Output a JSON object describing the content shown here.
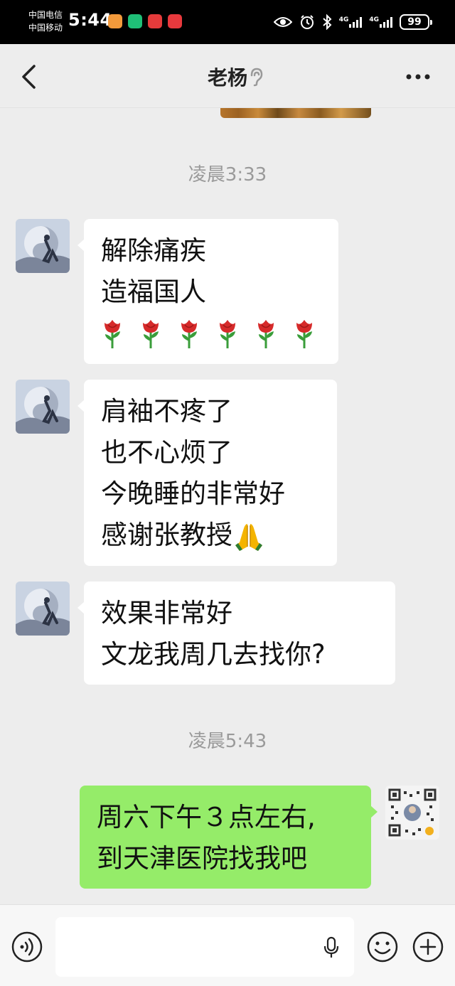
{
  "status_bar": {
    "carrier_1": "中国电信",
    "carrier_2": "中国移动",
    "time": "5:44",
    "network_1": "4G",
    "network_2": "4G",
    "battery": "99",
    "icons": [
      "health-app-icon",
      "hourglass-app-icon",
      "huawei-app-icon",
      "video-app-icon",
      "eye-icon",
      "alarm-icon",
      "bluetooth-icon",
      "signal-icon",
      "battery-icon"
    ]
  },
  "header": {
    "title": "老杨",
    "back_icon": "chevron-left-icon",
    "earpiece_icon": "ear-icon",
    "more_icon": "more-dots-icon"
  },
  "chat": {
    "timestamps": [
      "凌晨3:33",
      "凌晨5:43"
    ],
    "messages": [
      {
        "sender": "contact",
        "lines": [
          "解除痛疾",
          "造福国人"
        ],
        "emoji_row": [
          "🌹",
          "🌹",
          "🌹",
          "🌹",
          "🌹",
          "🌹"
        ]
      },
      {
        "sender": "contact",
        "lines": [
          "肩袖不疼了",
          "也不心烦了",
          "今晚睡的非常好",
          "感谢张教授"
        ],
        "trailing_emoji": "🙏"
      },
      {
        "sender": "contact",
        "lines": [
          "效果非常好",
          "文龙我周几去找你?"
        ]
      },
      {
        "sender": "me",
        "lines": [
          "周六下午３点左右,",
          "到天津医院找我吧"
        ]
      }
    ]
  },
  "input_bar": {
    "value": "",
    "voice_icon": "voice-mode-icon",
    "mic_icon": "mic-icon",
    "emoji_icon": "emoji-icon",
    "plus_icon": "plus-icon"
  },
  "colors": {
    "chat_background": "#ededed",
    "incoming_bubble": "#ffffff",
    "outgoing_bubble": "#95ec69",
    "timestamp_text": "#9a9a9a"
  }
}
